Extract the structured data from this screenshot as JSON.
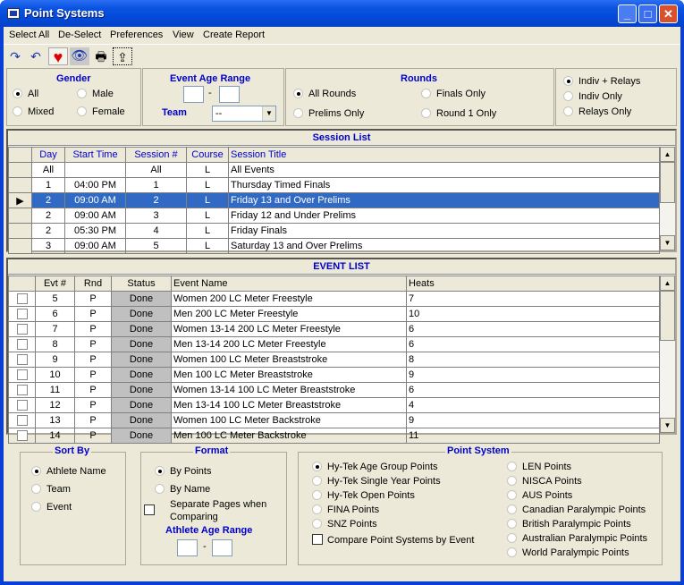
{
  "window": {
    "title": "Point Systems",
    "minimize_label": "_",
    "maximize_label": "□",
    "close_label": "✕"
  },
  "menu": [
    "Select All",
    "De-Select",
    "Preferences",
    "View",
    "Create Report"
  ],
  "toolbar": {
    "icons": [
      {
        "name": "redo-icon",
        "glyph": "↷"
      },
      {
        "name": "undo-icon",
        "glyph": "↶"
      },
      {
        "name": "heart-icon",
        "glyph": "♥"
      },
      {
        "name": "eye-icon",
        "glyph": "👁"
      },
      {
        "name": "printer-icon",
        "glyph": "🖶"
      },
      {
        "name": "folder-up-icon",
        "glyph": "⇪"
      }
    ]
  },
  "filters": {
    "gender": {
      "title": "Gender",
      "options": [
        "All",
        "Male",
        "Mixed",
        "Female"
      ],
      "selected": "All"
    },
    "event_age_range": {
      "title": "Event Age Range",
      "from": "",
      "to": "",
      "dash": "-"
    },
    "team": {
      "label": "Team",
      "value": "--"
    },
    "rounds": {
      "title": "Rounds",
      "options": [
        "All Rounds",
        "Finals Only",
        "Prelims Only",
        "Round 1 Only"
      ],
      "selected": "All Rounds"
    },
    "relays": {
      "options": [
        "Indiv + Relays",
        "Indiv Only",
        "Relays Only"
      ],
      "selected": "Indiv + Relays"
    }
  },
  "session_list": {
    "caption": "Session List",
    "columns": [
      "Day",
      "Start Time",
      "Session #",
      "Course",
      "Session Title"
    ],
    "rows": [
      {
        "day": "All",
        "start": "",
        "session": "All",
        "course": "L",
        "title": "All Events",
        "selected": false
      },
      {
        "day": "1",
        "start": "04:00 PM",
        "session": "1",
        "course": "L",
        "title": "Thursday Timed Finals",
        "selected": false
      },
      {
        "day": "2",
        "start": "09:00 AM",
        "session": "2",
        "course": "L",
        "title": "Friday 13 and Over Prelims",
        "selected": true
      },
      {
        "day": "2",
        "start": "09:00 AM",
        "session": "3",
        "course": "L",
        "title": "Friday 12 and Under Prelims",
        "selected": false
      },
      {
        "day": "2",
        "start": "05:30 PM",
        "session": "4",
        "course": "L",
        "title": "Friday Finals",
        "selected": false
      },
      {
        "day": "3",
        "start": "09:00 AM",
        "session": "5",
        "course": "L",
        "title": "Saturday 13 and Over Prelims",
        "selected": false
      }
    ]
  },
  "event_list": {
    "caption": "EVENT LIST",
    "columns": [
      "",
      "Evt #",
      "Rnd",
      "Status",
      "Event Name",
      "Heats"
    ],
    "rows": [
      {
        "evt": "5",
        "rnd": "P",
        "status": "Done",
        "name": "Women 200 LC Meter Freestyle",
        "heats": "7"
      },
      {
        "evt": "6",
        "rnd": "P",
        "status": "Done",
        "name": "Men 200 LC Meter Freestyle",
        "heats": "10"
      },
      {
        "evt": "7",
        "rnd": "P",
        "status": "Done",
        "name": "Women 13-14 200 LC Meter Freestyle",
        "heats": "6"
      },
      {
        "evt": "8",
        "rnd": "P",
        "status": "Done",
        "name": "Men 13-14 200 LC Meter Freestyle",
        "heats": "6"
      },
      {
        "evt": "9",
        "rnd": "P",
        "status": "Done",
        "name": "Women 100 LC Meter Breaststroke",
        "heats": "8"
      },
      {
        "evt": "10",
        "rnd": "P",
        "status": "Done",
        "name": "Men 100 LC Meter Breaststroke",
        "heats": "9"
      },
      {
        "evt": "11",
        "rnd": "P",
        "status": "Done",
        "name": "Women 13-14 100 LC Meter Breaststroke",
        "heats": "6"
      },
      {
        "evt": "12",
        "rnd": "P",
        "status": "Done",
        "name": "Men 13-14 100 LC Meter Breaststroke",
        "heats": "4"
      },
      {
        "evt": "13",
        "rnd": "P",
        "status": "Done",
        "name": "Women 100 LC Meter Backstroke",
        "heats": "9"
      },
      {
        "evt": "14",
        "rnd": "P",
        "status": "Done",
        "name": "Men 100 LC Meter Backstroke",
        "heats": "11"
      }
    ]
  },
  "sort_by": {
    "title": "Sort By",
    "options": [
      "Athlete Name",
      "Team",
      "Event"
    ],
    "selected": "Athlete Name"
  },
  "format": {
    "title": "Format",
    "options": [
      "By Points",
      "By Name"
    ],
    "selected": "By Points",
    "separate_pages_label_1": "Separate Pages when",
    "separate_pages_label_2": "Comparing",
    "separate_pages_checked": false,
    "athlete_age_range_title": "Athlete Age Range",
    "from": "",
    "to": "",
    "dash": "-"
  },
  "point_system": {
    "title": "Point System",
    "left_options": [
      "Hy-Tek Age Group Points",
      "Hy-Tek Single Year Points",
      "Hy-Tek Open Points",
      "FINA Points",
      "SNZ Points"
    ],
    "right_options": [
      "LEN Points",
      "NISCA Points",
      "AUS Points",
      "Canadian Paralympic Points",
      "British Paralympic Points",
      "Australian Paralympic Points",
      "World Paralympic Points"
    ],
    "selected": "Hy-Tek Age Group Points",
    "compare_label": "Compare Point Systems by Event",
    "compare_checked": false
  }
}
